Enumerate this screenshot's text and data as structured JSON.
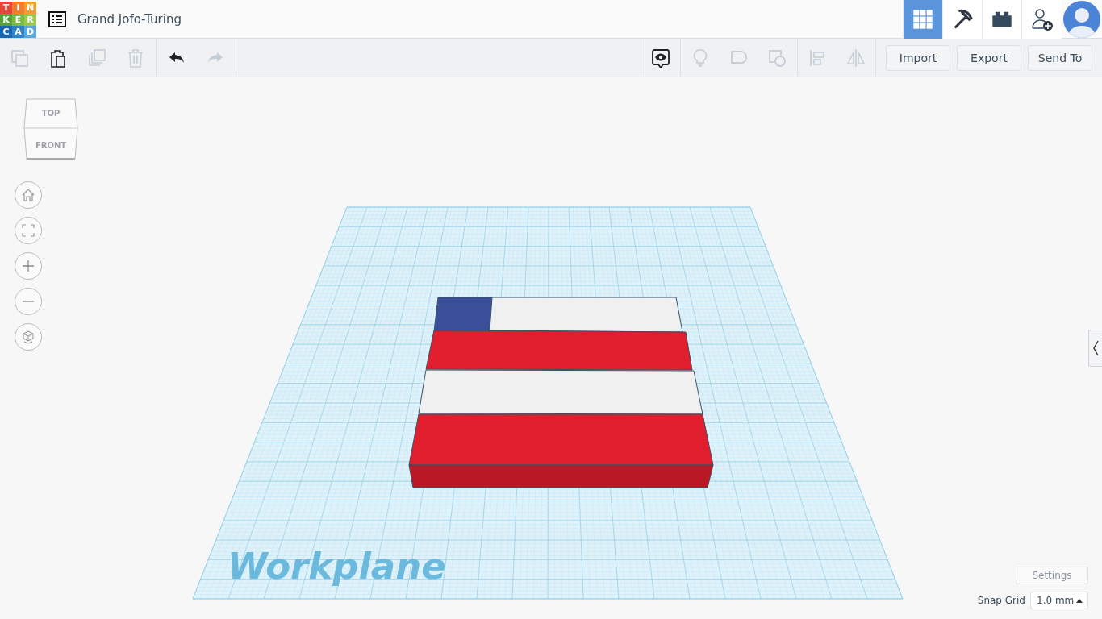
{
  "header": {
    "logo": [
      {
        "letter": "T",
        "color": "#e2463a"
      },
      {
        "letter": "I",
        "color": "#f07c2f"
      },
      {
        "letter": "N",
        "color": "#f49b33"
      },
      {
        "letter": "K",
        "color": "#59a03d"
      },
      {
        "letter": "E",
        "color": "#79b844"
      },
      {
        "letter": "R",
        "color": "#9bc94e"
      },
      {
        "letter": "C",
        "color": "#1a64b0"
      },
      {
        "letter": "A",
        "color": "#2e82c8"
      },
      {
        "letter": "D",
        "color": "#5aa7de"
      }
    ],
    "title": "Grand Jofo-Turing",
    "views": [
      {
        "kind": "grid",
        "selected": true
      },
      {
        "kind": "pickaxe",
        "selected": false
      },
      {
        "kind": "brick",
        "selected": false
      }
    ]
  },
  "toolbar": {
    "edit_tools": [
      {
        "kind": "copy",
        "disabled": true
      },
      {
        "kind": "paste",
        "disabled": false
      },
      {
        "kind": "duplicate",
        "disabled": true
      },
      {
        "kind": "delete",
        "disabled": true
      }
    ],
    "history_tools": [
      {
        "kind": "undo",
        "disabled": false
      },
      {
        "kind": "redo",
        "disabled": true
      }
    ],
    "shape_tools": [
      {
        "kind": "note",
        "disabled": false
      },
      {
        "kind": "bulb",
        "disabled": true
      },
      {
        "kind": "group",
        "disabled": true
      },
      {
        "kind": "ungroup",
        "disabled": true
      },
      {
        "kind": "align",
        "disabled": true
      },
      {
        "kind": "mirror",
        "disabled": true
      }
    ],
    "buttons": [
      "Import",
      "Export",
      "Send To"
    ]
  },
  "view_cube": {
    "top": "TOP",
    "front": "FRONT"
  },
  "workplane": {
    "label": "Workplane",
    "shapes": [
      {
        "color": "#3a4f9a"
      },
      {
        "color": "#f0f0f0"
      },
      {
        "color": "#e01e2d"
      },
      {
        "color": "#f0f0f0"
      },
      {
        "color": "#e01e2d"
      }
    ]
  },
  "settings_button": "Settings",
  "snap_grid": {
    "label": "Snap Grid",
    "value": "1.0 mm"
  }
}
